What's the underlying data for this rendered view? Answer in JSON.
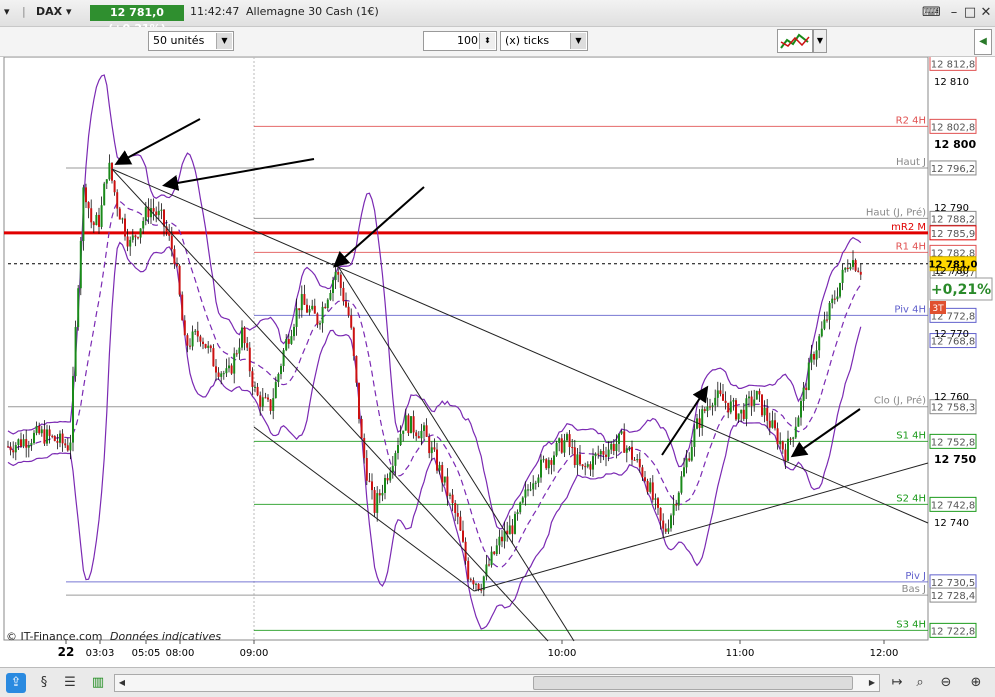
{
  "window": {
    "instrument_short": "DAX",
    "price_change": "12 781,0 (+0,21%)",
    "time": "11:42:47",
    "instrument_name": "Allemagne 30 Cash (1€)"
  },
  "toolbar": {
    "units_value": "50 unités",
    "ticks_count": "100",
    "ticks_unit": "(x) ticks"
  },
  "chart": {
    "watermark": "© IT-Finance.com",
    "watermark_note": "Données indicatives",
    "badge_change": "+0,21%",
    "badge_timeframe": "3T",
    "current_price": "12 781,0",
    "colors": {
      "up": "#1a8a1a",
      "down": "#cc1111",
      "bollinger": "#7b2ab3",
      "support": "#1a9a1a",
      "resistance": "#e05050",
      "pivot": "#6060cc",
      "neutral": "#888888",
      "strong": "#e00000"
    }
  },
  "axis": {
    "y_ticks": [
      "12 810",
      "12 800",
      "12 790",
      "12 780",
      "12 770",
      "12 760",
      "12 750",
      "12 740"
    ],
    "x_ticks": [
      {
        "label": "22",
        "strong": true
      },
      {
        "label": "03:03"
      },
      {
        "label": "05:05"
      },
      {
        "label": "08:00"
      },
      {
        "label": "09:00"
      },
      {
        "label": "10:00"
      },
      {
        "label": "11:00"
      },
      {
        "label": "12:00"
      }
    ]
  },
  "levels": [
    {
      "name": "R2 4H",
      "value": "12 802,8",
      "kind": "resistance"
    },
    {
      "name": "Haut J",
      "value": "12 796,2",
      "kind": "neutral"
    },
    {
      "name": "Haut (J, Pré)",
      "value": "12 788,2",
      "kind": "neutral"
    },
    {
      "name": "mR2 M",
      "value": "12 785,9",
      "kind": "strong"
    },
    {
      "name": "R1 4H",
      "value": "12 782,8",
      "kind": "resistance"
    },
    {
      "name": "",
      "value": "12 779,7",
      "kind": "neutral"
    },
    {
      "name": "Piv 4H",
      "value": "12 772,8",
      "kind": "pivot"
    },
    {
      "name": "",
      "value": "12 768,8",
      "kind": "pivot"
    },
    {
      "name": "Clo (J, Pré)",
      "value": "12 758,3",
      "kind": "neutral"
    },
    {
      "name": "S1 4H",
      "value": "12 752,8",
      "kind": "support"
    },
    {
      "name": "S2 4H",
      "value": "12 742,8",
      "kind": "support"
    },
    {
      "name": "Piv J",
      "value": "12 730,5",
      "kind": "pivot"
    },
    {
      "name": "Bas J",
      "value": "12 728,4",
      "kind": "neutral"
    },
    {
      "name": "S3 4H",
      "value": "12 722,8",
      "kind": "support"
    },
    {
      "name": "",
      "value": "12 812,8",
      "kind": "resistance"
    }
  ]
}
